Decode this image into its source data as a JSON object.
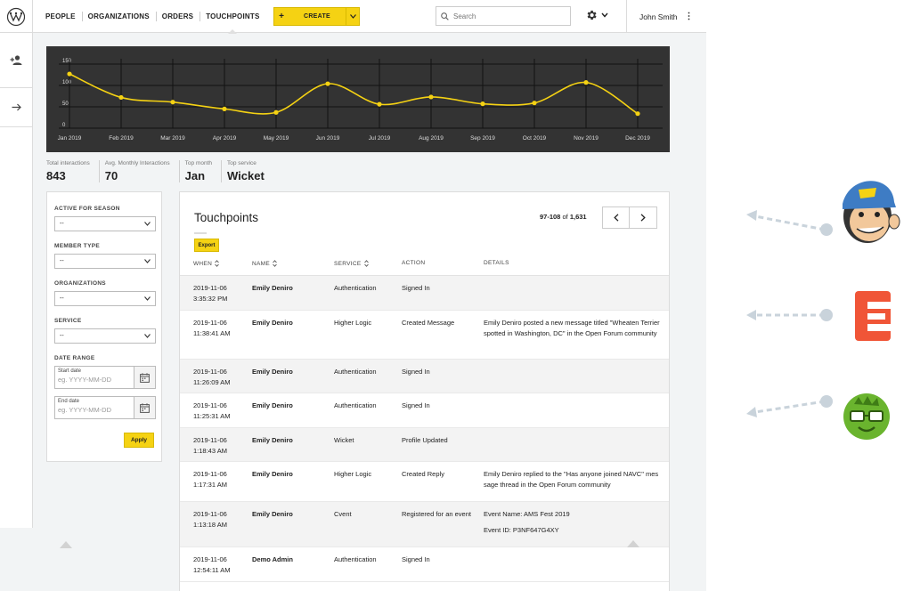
{
  "nav": {
    "items": [
      "PEOPLE",
      "ORGANIZATIONS",
      "ORDERS",
      "TOUCHPOINTS"
    ],
    "active_index": 3,
    "create_label": "CREATE",
    "create_plus": "+"
  },
  "search": {
    "placeholder": "Search"
  },
  "user": {
    "name": "John Smith"
  },
  "colors": {
    "accent": "#f5d213",
    "chart_bg": "#333333",
    "chart_line": "#f5d213"
  },
  "chart_data": {
    "type": "line",
    "categories": [
      "Jan 2019",
      "Feb 2019",
      "Mar 2019",
      "Apr 2019",
      "May 2019",
      "Jun 2019",
      "Jul 2019",
      "Aug 2019",
      "Sep 2019",
      "Oct 2019",
      "Nov 2019",
      "Dec 2019"
    ],
    "values": [
      127,
      72,
      61,
      45,
      37,
      104,
      56,
      73,
      57,
      59,
      107,
      34
    ],
    "yticks": [
      0,
      50,
      100,
      150
    ],
    "ylim": [
      0,
      150
    ],
    "grid": true
  },
  "stats": [
    {
      "label": "Total interactions",
      "value": "843"
    },
    {
      "label": "Avg. Monthly Interactions",
      "value": "70"
    },
    {
      "label": "Top month",
      "value": "Jan"
    },
    {
      "label": "Top service",
      "value": "Wicket"
    }
  ],
  "filters": {
    "active_for_season": {
      "label": "ACTIVE FOR SEASON",
      "value": "--"
    },
    "member_type": {
      "label": "MEMBER TYPE",
      "value": "--"
    },
    "organizations": {
      "label": "ORGANIZATIONS",
      "value": "--"
    },
    "service": {
      "label": "SERVICE",
      "value": "--"
    },
    "date_range": {
      "label": "DATE RANGE",
      "start_label": "Start date",
      "start_placeholder": "eg. YYYY-MM-DD",
      "end_label": "End date",
      "end_placeholder": "eg. YYYY-MM-DD"
    },
    "apply_label": "Apply"
  },
  "table": {
    "title": "Touchpoints",
    "export_label": "Export",
    "pager": {
      "range": "97-108",
      "of": "of",
      "total": "1,631"
    },
    "columns": [
      "WHEN",
      "NAME",
      "SERVICE",
      "ACTION",
      "DETAILS"
    ],
    "rows": [
      {
        "date": "2019-11-06",
        "time": "3:35:32 PM",
        "name": "Emily Deniro",
        "service": "Authentication",
        "action": "Signed In",
        "details": "",
        "details2": ""
      },
      {
        "date": "2019-11-06",
        "time": "11:38:41 AM",
        "name": "Emily Deniro",
        "service": "Higher Logic",
        "action": "Created Message",
        "details": "Emily Deniro posted a new message titled \"Wheaten Terrier spotted in Washington, DC\" in the Open Forum community",
        "details2": ""
      },
      {
        "date": "2019-11-06",
        "time": "11:26:09 AM",
        "name": "Emily Deniro",
        "service": "Authentication",
        "action": "Signed In",
        "details": "",
        "details2": ""
      },
      {
        "date": "2019-11-06",
        "time": "11:25:31 AM",
        "name": "Emily Deniro",
        "service": "Authentication",
        "action": "Signed In",
        "details": "",
        "details2": ""
      },
      {
        "date": "2019-11-06",
        "time": "1:18:43 AM",
        "name": "Emily Deniro",
        "service": "Wicket",
        "action": "Profile Updated",
        "details": "",
        "details2": ""
      },
      {
        "date": "2019-11-06",
        "time": "1:17:31 AM",
        "name": "Emily Deniro",
        "service": "Higher Logic",
        "action": "Created Reply",
        "details": "Emily Deniro replied to the \"Has anyone joined NAVC\" message thread in the Open Forum community",
        "details2": ""
      },
      {
        "date": "2019-11-06",
        "time": "1:13:18 AM",
        "name": "Emily Deniro",
        "service": "Cvent",
        "action": "Registered for an event",
        "details": "Event Name: AMS Fest 2019",
        "details2": "Event ID: P3NF647G4XY"
      },
      {
        "date": "2019-11-06",
        "time": "12:54:11 AM",
        "name": "Demo Admin",
        "service": "Authentication",
        "action": "Signed In",
        "details": "",
        "details2": ""
      }
    ]
  },
  "integrations": [
    "mailchimp-logo",
    "eventbrite-logo",
    "nerd-logo"
  ]
}
